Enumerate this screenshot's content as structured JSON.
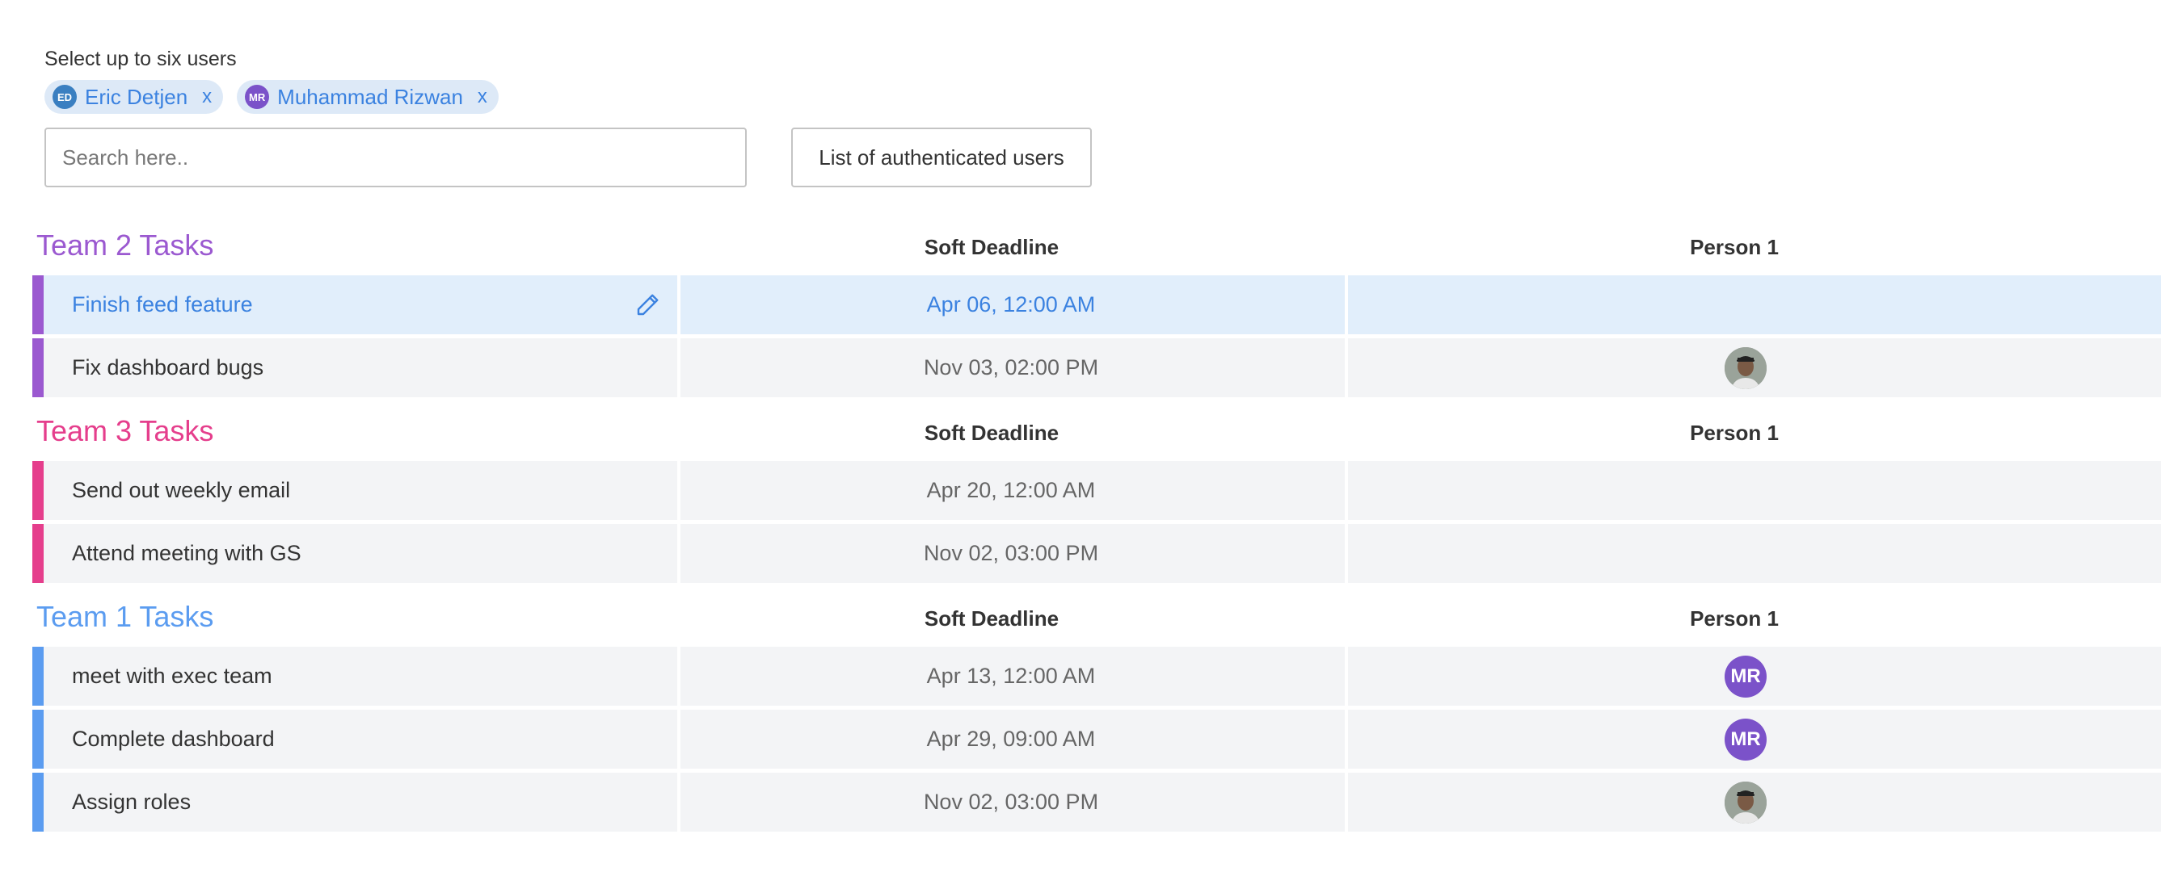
{
  "picker": {
    "label": "Select up to six users",
    "chips": [
      {
        "initials": "ED",
        "name": "Eric Detjen",
        "remove": "x",
        "color": "#3a7fc1"
      },
      {
        "initials": "MR",
        "name": "Muhammad Rizwan",
        "remove": "x",
        "color": "#7b52c9"
      }
    ]
  },
  "search": {
    "placeholder": "Search here.."
  },
  "auth_button": {
    "label": "List of authenticated users"
  },
  "groups": [
    {
      "title": "Team 2 Tasks",
      "color": "#9b59d0",
      "col_deadline": "Soft Deadline",
      "col_person": "Person 1",
      "rows": [
        {
          "task": "Finish feed feature",
          "deadline": "Apr 06, 12:00 AM",
          "person": null,
          "selected": true,
          "icon": "pencil-icon"
        },
        {
          "task": "Fix dashboard bugs",
          "deadline": "Nov 03, 02:00 PM",
          "person": "photo"
        }
      ]
    },
    {
      "title": "Team 3 Tasks",
      "color": "#e53e8c",
      "col_deadline": "Soft Deadline",
      "col_person": "Person 1",
      "rows": [
        {
          "task": "Send out weekly email",
          "deadline": "Apr 20, 12:00 AM",
          "person": null
        },
        {
          "task": "Attend meeting with GS",
          "deadline": "Nov 02, 03:00 PM",
          "person": null
        }
      ]
    },
    {
      "title": "Team 1 Tasks",
      "color": "#5b9cf0",
      "col_deadline": "Soft Deadline",
      "col_person": "Person 1",
      "rows": [
        {
          "task": "meet with exec team",
          "deadline": "Apr 13, 12:00 AM",
          "person": "MR"
        },
        {
          "task": "Complete dashboard",
          "deadline": "Apr 29, 09:00 AM",
          "person": "MR"
        },
        {
          "task": "Assign roles",
          "deadline": "Nov 02, 03:00 PM",
          "person": "photo"
        }
      ]
    }
  ],
  "colors": {
    "accent": "#3b82e0",
    "mr_avatar": "#7b52c9",
    "row_bg": "#f3f4f6",
    "selected_row_bg": "#e1eefb"
  }
}
